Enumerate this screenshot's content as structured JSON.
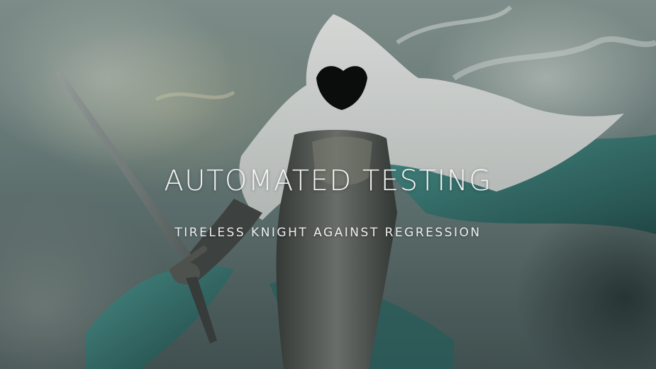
{
  "slide": {
    "title": "AUTOMATED TESTING",
    "subtitle": "TIRELESS KNIGHT AGAINST REGRESSION",
    "background_image": "hooded-knight-illustration"
  },
  "colors": {
    "sky": "#8fa09b",
    "cloak": "#e8ecea",
    "teal_cloth": "#2f7f7a",
    "armor": "#5a5f5c",
    "text": "#f2f2f2"
  }
}
